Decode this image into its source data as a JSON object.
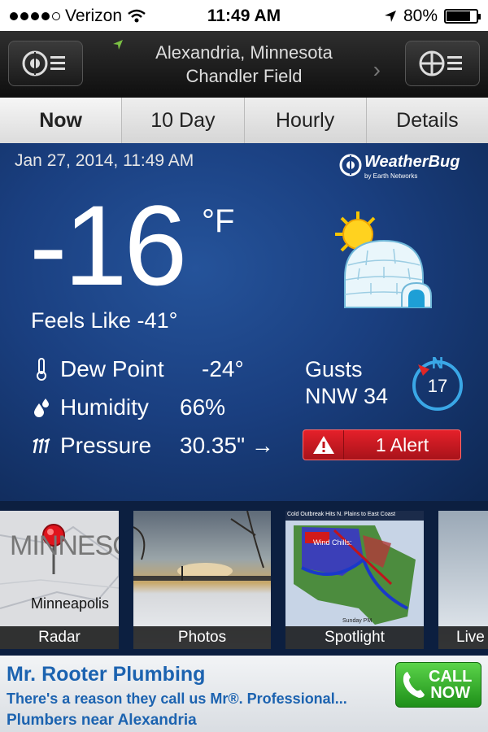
{
  "status_bar": {
    "carrier": "Verizon",
    "time": "11:49 AM",
    "battery": "80%",
    "battery_level": 0.8
  },
  "header": {
    "city": "Alexandria, Minnesota",
    "station": "Chandler Field"
  },
  "tabs": [
    {
      "label": "Now",
      "active": true
    },
    {
      "label": "10 Day",
      "active": false
    },
    {
      "label": "Hourly",
      "active": false
    },
    {
      "label": "Details",
      "active": false
    }
  ],
  "current": {
    "date": "Jan 27, 2014, 11:49 AM",
    "logo_name": "WeatherBug",
    "logo_sub": "by Earth Networks",
    "temperature": "-16",
    "unit": "°F",
    "feels_like": "Feels Like -41°",
    "dew_point_label": "Dew Point",
    "dew_point_value": "-24°",
    "humidity_label": "Humidity",
    "humidity_value": "66%",
    "pressure_label": "Pressure",
    "pressure_value": "30.35\" →",
    "gusts_label": "Gusts",
    "gusts_value": "NNW 34",
    "compass_dir": "N",
    "compass_value": "17",
    "alert_label": "1 Alert"
  },
  "thumbnails": {
    "radar_label": "Radar",
    "radar_map_text": "MINNESO",
    "radar_city": "Minneapolis",
    "photos_label": "Photos",
    "spotlight_label": "Spotlight",
    "spotlight_title": "Cold Outbreak Hits N. Plains to East Coast",
    "spotlight_wind_chills": "Wind Chills:",
    "spotlight_footer": "Sunday PM",
    "live_label": "Live"
  },
  "ad": {
    "title": "Mr. Rooter Plumbing",
    "subtitle": "There's a reason they call us Mr®. Professional...",
    "footer": "Plumbers near Alexandria",
    "call_line1": "CALL",
    "call_line2": "NOW"
  },
  "colors": {
    "panel": "#1a3f80",
    "alert": "#d61f26",
    "ad_text": "#1c63b0",
    "call_button": "#2fa626"
  }
}
